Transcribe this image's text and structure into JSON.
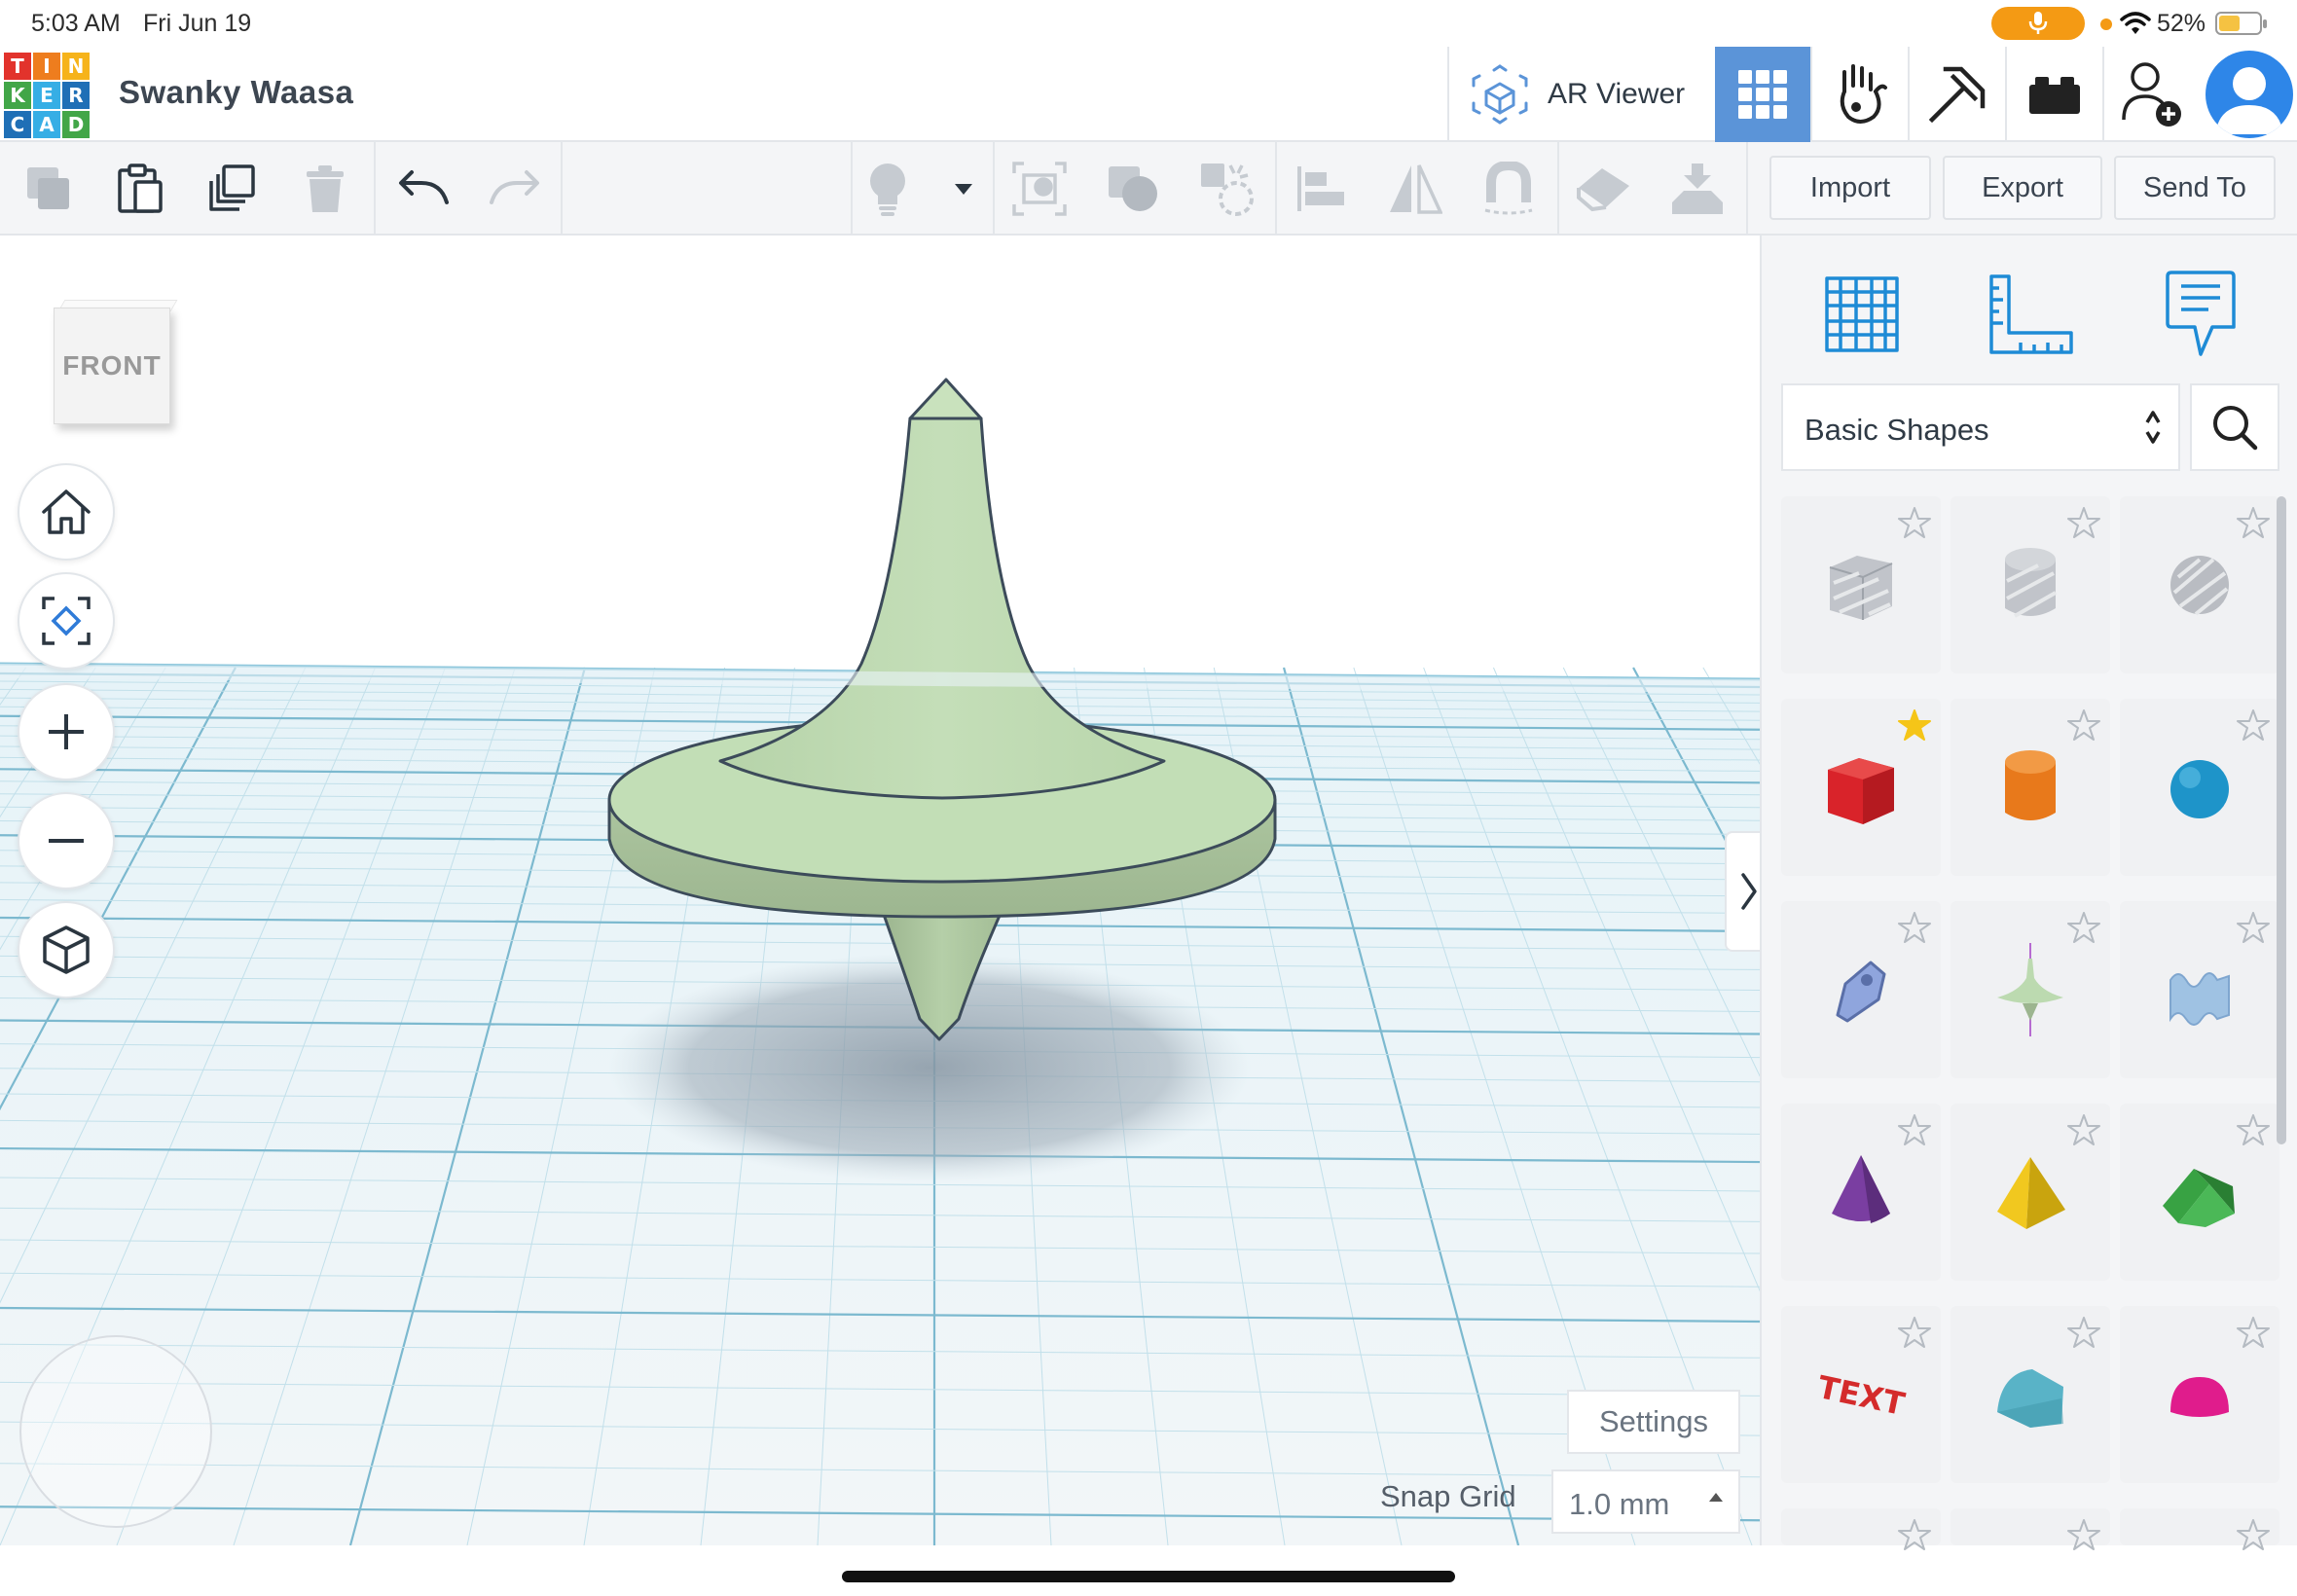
{
  "status_bar": {
    "time": "5:03 AM",
    "date": "Fri Jun 19",
    "battery": "52%",
    "battery_level": 0.52
  },
  "logo": {
    "letters": [
      "T",
      "I",
      "N",
      "K",
      "E",
      "R",
      "C",
      "A",
      "D"
    ],
    "colors": [
      "#e2332c",
      "#ee7d1e",
      "#f6b31a",
      "#42a648",
      "#36aee5",
      "#1f6fb6",
      "#1f6fb6",
      "#36aee5",
      "#42a648"
    ]
  },
  "header": {
    "project_title": "Swanky Waasa",
    "ar_viewer_label": "AR Viewer",
    "active_view": "3d-design",
    "accent_color": "#5b94d8"
  },
  "toolbar": {
    "import_label": "Import",
    "export_label": "Export",
    "send_to_label": "Send To"
  },
  "viewport": {
    "view_cube_label": "FRONT",
    "settings_label": "Settings",
    "snap_grid_label": "Snap Grid",
    "snap_grid_value": "1.0 mm",
    "model_color": "#bcdab0"
  },
  "right_panel": {
    "category": "Basic Shapes",
    "shapes": [
      {
        "name": "box-hole",
        "color": "#b9bcc2",
        "starred": false
      },
      {
        "name": "cylinder-hole",
        "color": "#b9bcc2",
        "starred": false
      },
      {
        "name": "sphere-hole",
        "color": "#b9bcc2",
        "starred": false
      },
      {
        "name": "box",
        "color": "#d9232a",
        "starred": true
      },
      {
        "name": "cylinder",
        "color": "#e8791b",
        "starred": false
      },
      {
        "name": "sphere",
        "color": "#1e94c9",
        "starred": false
      },
      {
        "name": "scribble",
        "color": "#8fa5dd",
        "starred": false
      },
      {
        "name": "spinning-top",
        "color": "#bcdab0",
        "starred": false
      },
      {
        "name": "wave",
        "color": "#9fc2e3",
        "starred": false
      },
      {
        "name": "cone",
        "color": "#7a3ea1",
        "starred": false
      },
      {
        "name": "pyramid",
        "color": "#f1c81f",
        "starred": false
      },
      {
        "name": "roof",
        "color": "#38a243",
        "starred": false
      },
      {
        "name": "text",
        "color": "#d42b2b",
        "starred": false
      },
      {
        "name": "half-cylinder",
        "color": "#59b3c7",
        "starred": false
      },
      {
        "name": "half-sphere",
        "color": "#e01c8c",
        "starred": false
      }
    ]
  }
}
